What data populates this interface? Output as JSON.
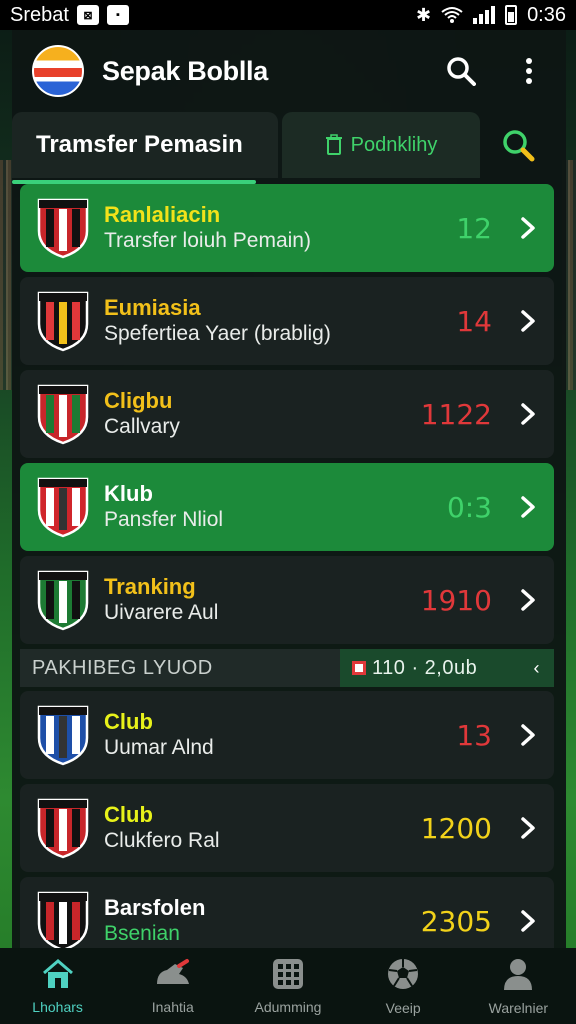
{
  "status_bar": {
    "carrier": "Srebat",
    "time": "0:36"
  },
  "app": {
    "title": "Sepak Boblla"
  },
  "tabs": {
    "active": "Tramsfer Pemasin",
    "secondary": "Podnklihy"
  },
  "colors": {
    "accent_green": "#1c8a3a",
    "value_green": "#3fd26a",
    "value_red": "#e0383a",
    "value_yellow": "#f2d21a",
    "club_yellow": "#e8d21e"
  },
  "rows": [
    {
      "title": "Ranlaliacin",
      "subtitle": "Trarsfer loiuh Pemain)",
      "value": "12",
      "highlight": true,
      "title_color": "#f2e21a",
      "value_color": "#3fd26a"
    },
    {
      "title": "Eumiasia",
      "subtitle": "Spefertiea Yaer (brablig)",
      "value": "14",
      "highlight": false,
      "title_color": "#f2c01a",
      "value_color": "#e0383a"
    },
    {
      "title": "Cligbu",
      "subtitle": "Callvary",
      "value": "1122",
      "highlight": false,
      "title_color": "#f2c01a",
      "value_color": "#e0383a"
    },
    {
      "title": "Klub",
      "subtitle": "Pansfer Nliol",
      "value": "0:3",
      "highlight": true,
      "title_color": "#ffffff",
      "value_color": "#3fd26a"
    },
    {
      "title": "Tranking",
      "subtitle": "Uivarere Aul",
      "value": "1910",
      "highlight": false,
      "title_color": "#f2c01a",
      "value_color": "#e0383a"
    }
  ],
  "section": {
    "label": "PAKHIBEG LYUOD",
    "meta": "110 · 2,0ub"
  },
  "rows2": [
    {
      "title": "Club",
      "subtitle": "Uumar Alnd",
      "value": "13",
      "highlight": false,
      "title_color": "#e8f21a",
      "value_color": "#e0383a"
    },
    {
      "title": "Club",
      "subtitle": "Clukfero Ral",
      "value": "1200",
      "highlight": false,
      "title_color": "#e8f21a",
      "value_color": "#f2d21a"
    },
    {
      "title": "Barsfolen",
      "subtitle": "Bsenian",
      "value": "2305",
      "highlight": false,
      "title_color": "#ffffff",
      "value_color": "#f2d21a"
    }
  ],
  "nav": [
    {
      "label": "Lhohars",
      "icon": "home-icon"
    },
    {
      "label": "Inahtia",
      "icon": "boot-icon"
    },
    {
      "label": "Adumming",
      "icon": "grid-icon"
    },
    {
      "label": "Veeip",
      "icon": "ball-icon"
    },
    {
      "label": "Warelnier",
      "icon": "profile-icon"
    }
  ]
}
